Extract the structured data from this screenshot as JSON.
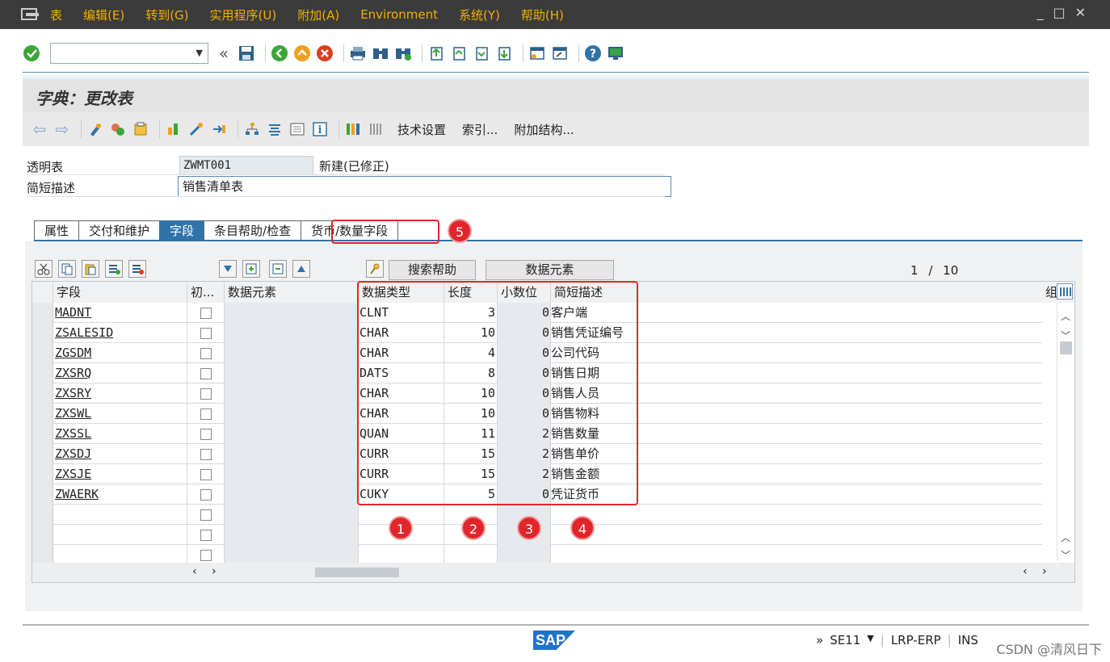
{
  "menu": [
    "表",
    "编辑(E)",
    "转到(G)",
    "实用程序(U)",
    "附加(A)",
    "Environment",
    "系统(Y)",
    "帮助(H)"
  ],
  "window_controls": [
    "_",
    "□",
    "✕"
  ],
  "icons": {
    "ok": "check-circle-icon",
    "save": "save-icon",
    "back": "back-icon",
    "exit": "exit-icon",
    "cancel": "cancel-icon",
    "print": "print-icon",
    "find": "binoculars-icon",
    "help": "help-icon",
    "monitor": "monitor-icon"
  },
  "colors": {
    "menu_bg": "#3b3b3b",
    "menu_fg": "#f0b000",
    "accent": "#2f73a9",
    "annotation": "#e0262b"
  },
  "title": "字典：更改表",
  "app_toolbar": [
    "技术设置",
    "索引...",
    "附加结构..."
  ],
  "header": {
    "table_label": "透明表",
    "table_name": "ZWMT001",
    "table_status": "新建(已修正)",
    "desc_label": "简短描述",
    "desc_value": "销售清单表"
  },
  "tabs": [
    "属性",
    "交付和维护",
    "字段",
    "条目帮助/检查",
    "货币/数量字段"
  ],
  "active_tab": "字段",
  "table_toolbar": {
    "search_help": "搜索帮助",
    "data_element": "数据元素"
  },
  "pager": {
    "current": "1",
    "sep": "/",
    "total": "10"
  },
  "columns": {
    "field": "字段",
    "init": "初...",
    "data_element": "数据元素",
    "data_type": "数据类型",
    "length": "长度",
    "decimals": "小数位",
    "short_desc": "简短描述",
    "group": "组"
  },
  "rows": [
    {
      "field": "MADNT",
      "type": "CLNT",
      "len": "3",
      "dec": "0",
      "desc": "客户端"
    },
    {
      "field": "ZSALESID",
      "type": "CHAR",
      "len": "10",
      "dec": "0",
      "desc": "销售凭证编号"
    },
    {
      "field": "ZGSDM",
      "type": "CHAR",
      "len": "4",
      "dec": "0",
      "desc": "公司代码"
    },
    {
      "field": "ZXSRQ",
      "type": "DATS",
      "len": "8",
      "dec": "0",
      "desc": "销售日期"
    },
    {
      "field": "ZXSRY",
      "type": "CHAR",
      "len": "10",
      "dec": "0",
      "desc": "销售人员"
    },
    {
      "field": "ZXSWL",
      "type": "CHAR",
      "len": "10",
      "dec": "0",
      "desc": "销售物料"
    },
    {
      "field": "ZXSSL",
      "type": "QUAN",
      "len": "11",
      "dec": "2",
      "desc": "销售数量"
    },
    {
      "field": "ZXSDJ",
      "type": "CURR",
      "len": "15",
      "dec": "2",
      "desc": "销售单价"
    },
    {
      "field": "ZXSJE",
      "type": "CURR",
      "len": "15",
      "dec": "2",
      "desc": "销售金额"
    },
    {
      "field": "ZWAERK",
      "type": "CUKY",
      "len": "5",
      "dec": "0",
      "desc": "凭证货币"
    }
  ],
  "badges": [
    "1",
    "2",
    "3",
    "4",
    "5"
  ],
  "status": {
    "arrows": "»",
    "tcode": "SE11",
    "system": "LRP-ERP",
    "mode": "INS"
  },
  "logo": "SAP",
  "watermark": "CSDN @清风日下"
}
